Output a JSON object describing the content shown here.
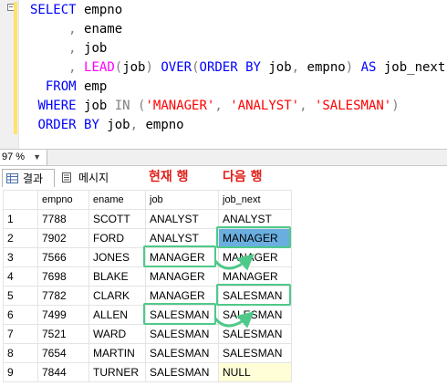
{
  "editor": {
    "lines": [
      {
        "tokens": [
          {
            "t": "SELECT",
            "c": "kw"
          },
          {
            "t": " empno",
            "c": ""
          }
        ]
      },
      {
        "tokens": [
          {
            "t": "     ",
            "c": ""
          },
          {
            "t": ",",
            "c": "op"
          },
          {
            "t": " ename",
            "c": ""
          }
        ]
      },
      {
        "tokens": [
          {
            "t": "     ",
            "c": ""
          },
          {
            "t": ",",
            "c": "op"
          },
          {
            "t": " job",
            "c": ""
          }
        ]
      },
      {
        "tokens": [
          {
            "t": "     ",
            "c": ""
          },
          {
            "t": ",",
            "c": "op"
          },
          {
            "t": " ",
            "c": ""
          },
          {
            "t": "LEAD",
            "c": "fn"
          },
          {
            "t": "(",
            "c": "op"
          },
          {
            "t": "job",
            "c": ""
          },
          {
            "t": ")",
            "c": "op"
          },
          {
            "t": " ",
            "c": ""
          },
          {
            "t": "OVER",
            "c": "kw"
          },
          {
            "t": "(",
            "c": "op"
          },
          {
            "t": "ORDER BY",
            "c": "kw"
          },
          {
            "t": " job",
            "c": ""
          },
          {
            "t": ",",
            "c": "op"
          },
          {
            "t": " empno",
            "c": ""
          },
          {
            "t": ")",
            "c": "op"
          },
          {
            "t": " ",
            "c": ""
          },
          {
            "t": "AS",
            "c": "kw"
          },
          {
            "t": " job_next",
            "c": ""
          }
        ]
      },
      {
        "tokens": [
          {
            "t": "  ",
            "c": ""
          },
          {
            "t": "FROM",
            "c": "kw"
          },
          {
            "t": " emp",
            "c": ""
          }
        ]
      },
      {
        "tokens": [
          {
            "t": " ",
            "c": ""
          },
          {
            "t": "WHERE",
            "c": "kw"
          },
          {
            "t": " job ",
            "c": ""
          },
          {
            "t": "IN",
            "c": "op"
          },
          {
            "t": " ",
            "c": ""
          },
          {
            "t": "(",
            "c": "op"
          },
          {
            "t": "'MANAGER'",
            "c": "str"
          },
          {
            "t": ",",
            "c": "op"
          },
          {
            "t": " ",
            "c": ""
          },
          {
            "t": "'ANALYST'",
            "c": "str"
          },
          {
            "t": ",",
            "c": "op"
          },
          {
            "t": " ",
            "c": ""
          },
          {
            "t": "'SALESMAN'",
            "c": "str"
          },
          {
            "t": ")",
            "c": "op"
          }
        ]
      },
      {
        "tokens": [
          {
            "t": " ",
            "c": ""
          },
          {
            "t": "ORDER BY",
            "c": "kw"
          },
          {
            "t": " job",
            "c": ""
          },
          {
            "t": ",",
            "c": "op"
          },
          {
            "t": " empno",
            "c": ""
          }
        ]
      }
    ]
  },
  "zoom": {
    "value": "97 %"
  },
  "tabs": {
    "results": "결과",
    "messages": "메시지"
  },
  "annotations": {
    "current_row": "현재 행",
    "next_row": "다음 행"
  },
  "results": {
    "columns": [
      "",
      "empno",
      "ename",
      "job",
      "job_next"
    ],
    "rows": [
      [
        "1",
        "7788",
        "SCOTT",
        "ANALYST",
        "ANALYST"
      ],
      [
        "2",
        "7902",
        "FORD",
        "ANALYST",
        "MANAGER"
      ],
      [
        "3",
        "7566",
        "JONES",
        "MANAGER",
        "MANAGER"
      ],
      [
        "4",
        "7698",
        "BLAKE",
        "MANAGER",
        "MANAGER"
      ],
      [
        "5",
        "7782",
        "CLARK",
        "MANAGER",
        "SALESMAN"
      ],
      [
        "6",
        "7499",
        "ALLEN",
        "SALESMAN",
        "SALESMAN"
      ],
      [
        "7",
        "7521",
        "WARD",
        "SALESMAN",
        "SALESMAN"
      ],
      [
        "8",
        "7654",
        "MARTIN",
        "SALESMAN",
        "SALESMAN"
      ],
      [
        "9",
        "7844",
        "TURNER",
        "SALESMAN",
        "NULL"
      ]
    ]
  },
  "colors": {
    "highlight": "#4fc98a",
    "annotation": "#e0201b",
    "selected_cell": "#6aaee0",
    "null_cell": "#fffed7"
  }
}
